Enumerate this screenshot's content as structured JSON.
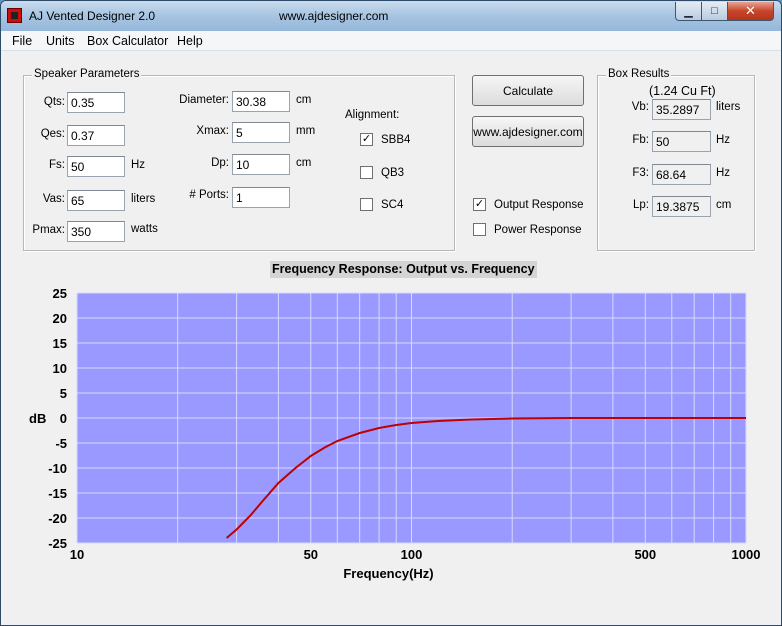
{
  "window": {
    "title": "AJ Vented Designer 2.0",
    "url_caption": "www.ajdesigner.com",
    "minimize_glyph": "▁",
    "maximize_glyph": "□",
    "close_glyph": "✕"
  },
  "menu": [
    "File",
    "Units",
    "Box Calculator",
    "Help"
  ],
  "speaker": {
    "legend": "Speaker Parameters",
    "qts": {
      "label": "Qts:",
      "value": "0.35"
    },
    "qes": {
      "label": "Qes:",
      "value": "0.37"
    },
    "fs": {
      "label": "Fs:",
      "value": "50",
      "unit": "Hz"
    },
    "vas": {
      "label": "Vas:",
      "value": "65",
      "unit": "liters"
    },
    "pmax": {
      "label": "Pmax:",
      "value": "350",
      "unit": "watts"
    },
    "diameter": {
      "label": "Diameter:",
      "value": "30.38",
      "unit": "cm"
    },
    "xmax": {
      "label": "Xmax:",
      "value": "5",
      "unit": "mm"
    },
    "dp": {
      "label": "Dp:",
      "value": "10",
      "unit": "cm"
    },
    "ports": {
      "label": "# Ports:",
      "value": "1"
    },
    "alignment_label": "Alignment:",
    "alignments": [
      {
        "label": "SBB4",
        "checked": true
      },
      {
        "label": "QB3",
        "checked": false
      },
      {
        "label": "SC4",
        "checked": false
      }
    ]
  },
  "actions": {
    "calculate": "Calculate",
    "website": "www.ajdesigner.com",
    "output_response": {
      "label": "Output Response",
      "checked": true
    },
    "power_response": {
      "label": "Power Response",
      "checked": false
    }
  },
  "box": {
    "legend": "Box Results",
    "cuft": "(1.24 Cu Ft)",
    "vb": {
      "label": "Vb:",
      "value": "35.2897",
      "unit": "liters"
    },
    "fb": {
      "label": "Fb:",
      "value": "50",
      "unit": "Hz"
    },
    "f3": {
      "label": "F3:",
      "value": "68.64",
      "unit": "Hz"
    },
    "lp": {
      "label": "Lp:",
      "value": "19.3875",
      "unit": "cm"
    }
  },
  "chart_data": {
    "type": "line",
    "title": "Frequency Response: Output vs. Frequency",
    "xlabel": "Frequency(Hz)",
    "ylabel": "dB",
    "xscale": "log",
    "xlim": [
      10,
      1000
    ],
    "ylim": [
      -25,
      25
    ],
    "yticks": [
      25,
      20,
      15,
      10,
      5,
      0,
      -5,
      -10,
      -15,
      -20,
      -25
    ],
    "xtick_labels": [
      10,
      50,
      100,
      500,
      1000
    ],
    "grid": true,
    "plot_background": "#9999ff",
    "series": [
      {
        "color": "#c00000",
        "x": [
          28,
          30,
          33,
          36,
          40,
          45,
          50,
          55,
          60,
          70,
          80,
          90,
          100,
          120,
          150,
          200,
          300,
          500,
          1000
        ],
        "y": [
          -24,
          -22.3,
          -19.5,
          -16.5,
          -13,
          -10,
          -7.6,
          -5.9,
          -4.6,
          -3,
          -2,
          -1.4,
          -1,
          -0.6,
          -0.3,
          -0.1,
          0,
          0,
          0
        ]
      }
    ]
  }
}
